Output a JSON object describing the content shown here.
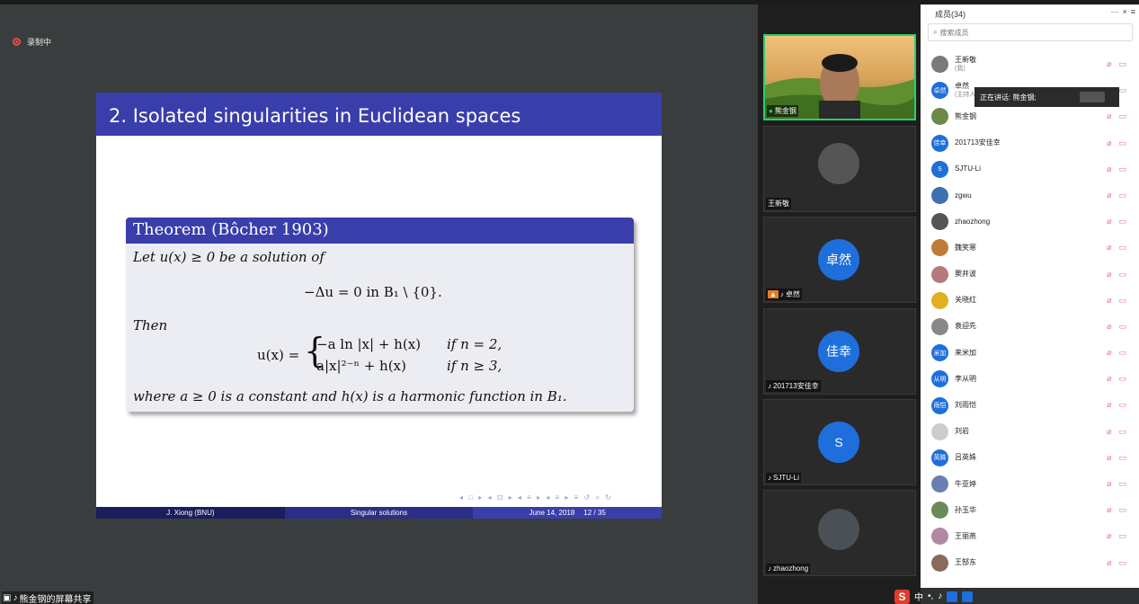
{
  "recording": {
    "label": "录制中"
  },
  "slide": {
    "title": "2. Isolated singularities in Euclidean spaces",
    "theorem_title": "Theorem (Bôcher 1903)",
    "line1": "Let u(x) ≥ 0 be a solution of",
    "equation": "−Δu = 0    in B₁ \\ {0}.",
    "then": "Then",
    "case_lhs": "u(x) =",
    "case1_expr": "−a ln |x| + h(x)",
    "case1_cond": "if n = 2,",
    "case2_expr": "a|x|²⁻ⁿ + h(x)",
    "case2_cond": "if n ≥ 3,",
    "closing": "where a ≥ 0 is a constant and h(x) is a harmonic function in B₁.",
    "footer_author": "J. Xiong  (BNU)",
    "footer_topic": "Singular solutions",
    "footer_date": "June 14, 2018",
    "footer_page": "12 / 35",
    "nav": "◂ □ ▸ ◂ ⊡ ▸ ◂ ≡ ▸ ◂ ≡ ▸   ≡   ↺ ⌕ ↻"
  },
  "share_label": "熊金钢的屏幕共享",
  "video_tiles": [
    {
      "name": "熊金钢",
      "type": "photo"
    },
    {
      "name": "王新敬",
      "type": "logo"
    },
    {
      "name": "卓然",
      "type": "avatar",
      "avatar_text": "卓然"
    },
    {
      "name": "201713安佳幸",
      "type": "avatar",
      "avatar_text": "佳幸"
    },
    {
      "name": "SJTU-Li",
      "type": "avatar",
      "avatar_text": "S"
    },
    {
      "name": "zhaozhong",
      "type": "photo2"
    }
  ],
  "panel": {
    "title": "成员(34)",
    "ctrl_more": "···",
    "ctrl_close": "×",
    "ctrl_menu": "≡",
    "search_placeholder": "搜索成员",
    "speaking_label": "正在讲话: 熊金钢;"
  },
  "members": [
    {
      "name": "王新敬",
      "sub": "(我)",
      "av": "",
      "color": "#7a7a7a"
    },
    {
      "name": "卓然",
      "sub": "(主持人)",
      "av": "卓然",
      "color": "#1e6fdc"
    },
    {
      "name": "熊金钢",
      "sub": "",
      "av": "",
      "color": "#6b8a4a"
    },
    {
      "name": "201713安佳幸",
      "sub": "",
      "av": "佳幸",
      "color": "#1e6fdc"
    },
    {
      "name": "SJTU-Li",
      "sub": "",
      "av": "S",
      "color": "#1e6fdc"
    },
    {
      "name": "zgwu",
      "sub": "",
      "av": "",
      "color": "#3f6fb0"
    },
    {
      "name": "zhaozhong",
      "sub": "",
      "av": "",
      "color": "#555555"
    },
    {
      "name": "魏笑寒",
      "sub": "",
      "av": "",
      "color": "#c07a3a"
    },
    {
      "name": "窦井波",
      "sub": "",
      "av": "",
      "color": "#b57a7a"
    },
    {
      "name": "关晓红",
      "sub": "",
      "av": "",
      "color": "#e0b020"
    },
    {
      "name": "袁迎先",
      "sub": "",
      "av": "",
      "color": "#888888"
    },
    {
      "name": "来米加",
      "sub": "",
      "av": "米加",
      "color": "#1e6fdc"
    },
    {
      "name": "李从明",
      "sub": "",
      "av": "从明",
      "color": "#1e6fdc"
    },
    {
      "name": "刘雨恺",
      "sub": "",
      "av": "雨恺",
      "color": "#1e6fdc"
    },
    {
      "name": "刘岩",
      "sub": "",
      "av": "",
      "color": "#cccccc"
    },
    {
      "name": "吕英姝",
      "sub": "",
      "av": "英姝",
      "color": "#1e6fdc"
    },
    {
      "name": "牛亚婷",
      "sub": "",
      "av": "",
      "color": "#6a7fb0"
    },
    {
      "name": "孙玉华",
      "sub": "",
      "av": "",
      "color": "#6a8a5a"
    },
    {
      "name": "王丽燕",
      "sub": "",
      "av": "",
      "color": "#b08aa0"
    },
    {
      "name": "王郜东",
      "sub": "",
      "av": "",
      "color": "#8a6a5a"
    }
  ],
  "ime": {
    "logo": "S",
    "mode": "中"
  }
}
